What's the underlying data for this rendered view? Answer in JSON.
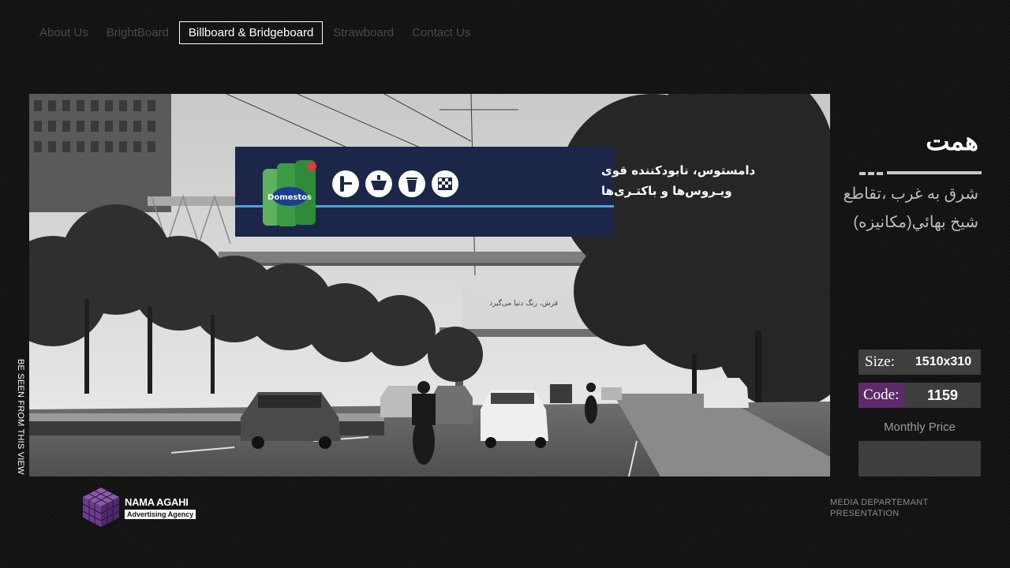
{
  "nav": {
    "items": [
      {
        "label": "About Us"
      },
      {
        "label": "BrightBoard"
      },
      {
        "label": "Billboard & Bridgeboard"
      },
      {
        "label": "Strawboard"
      },
      {
        "label": "Contact Us"
      }
    ],
    "active_index": 2
  },
  "photo": {
    "billboard_main_text_line1": "دامستوس، نابودکننده قوی",
    "billboard_main_text_line2": "ویـروس‌ها و باکتـری‌ها",
    "billboard_brand": "Domestos",
    "billboard_second_text": "فرش، رنگ دنیا می‌گیرد"
  },
  "side_caption": "BE SEEN FROM THIS VIEW",
  "location": {
    "title": "همت",
    "address_line1": "شرق به غرب ،تقاطع",
    "address_line2": "شيخ بهائي(مكانيزه)"
  },
  "specs": {
    "size_label": "Size:",
    "size_value": "1510x310",
    "code_label": "Code:",
    "code_value": "1159",
    "price_label": "Monthly Price",
    "price_value": ""
  },
  "logo": {
    "name": "NAMA AGAHI",
    "tagline": "Advertising Agency"
  },
  "footer": {
    "line1": "MEDIA DEPARTEMANT",
    "line2": "PRESENTATION"
  },
  "colors": {
    "background": "#121212",
    "accent_purple": "#5f2a6b",
    "info_box": "#3e3e3e",
    "billboard_navy": "#1c2648"
  }
}
